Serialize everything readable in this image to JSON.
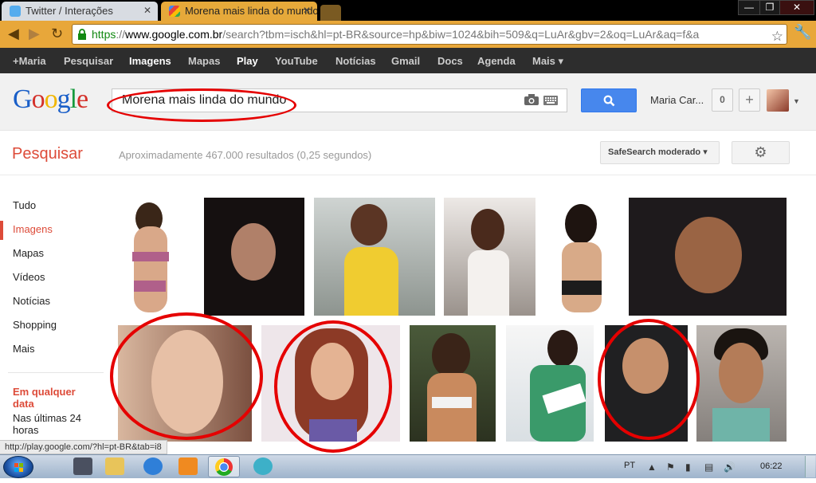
{
  "browser": {
    "tabs": [
      {
        "title": "Twitter / Interações",
        "active": false
      },
      {
        "title": "Morena mais linda do mundo",
        "active": true
      }
    ],
    "window_controls": [
      "—",
      "❐",
      "✕"
    ],
    "url": {
      "scheme": "https",
      "separator": "://",
      "host": "www.google.com.br",
      "path": "/search?tbm=isch&hl=pt-BR&source=hp&biw=1024&bih=509&q=LuAr&gbv=2&oq=LuAr&aq=f&a"
    }
  },
  "gbar": {
    "items": [
      "+Maria",
      "Pesquisar",
      "Imagens",
      "Mapas",
      "Play",
      "YouTube",
      "Notícias",
      "Gmail",
      "Docs",
      "Agenda",
      "Mais ▾"
    ]
  },
  "header": {
    "logo": [
      "G",
      "o",
      "o",
      "g",
      "l",
      "e"
    ],
    "search_value": "Morena mais linda do mundo",
    "username": "Maria Car...",
    "notifications": "0",
    "share": "+"
  },
  "subbar": {
    "label": "Pesquisar",
    "results": "Aproximadamente 467.000 resultados (0,25 segundos)",
    "safesearch": "SafeSearch moderado ▾"
  },
  "leftnav": {
    "items": [
      "Tudo",
      "Imagens",
      "Mapas",
      "Vídeos",
      "Notícias",
      "Shopping",
      "Mais"
    ],
    "selected": "Imagens",
    "time_heading": "Em qualquer data",
    "time_option": "Nas últimas 24 horas"
  },
  "status_url": "http://play.google.com/?hl=pt-BR&tab=i8",
  "taskbar": {
    "lang": "PT",
    "clock": "06:22"
  },
  "colors": {
    "accent_red": "#dd4b39",
    "search_blue": "#4787ed",
    "annotation_red": "#e50000",
    "gbar_dark": "#2d2d2d",
    "chrome_orange": "#e8a73a"
  }
}
